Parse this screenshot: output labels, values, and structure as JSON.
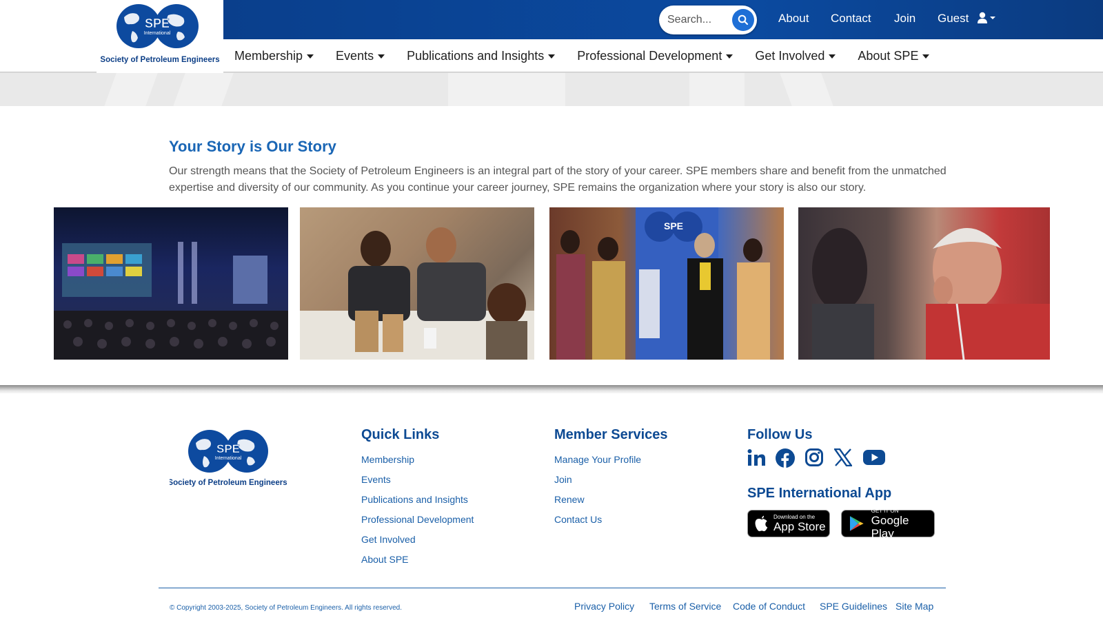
{
  "brand": {
    "logo_text": "SPE",
    "logo_subtext": "International",
    "org_name": "Society of Petroleum Engineers"
  },
  "topbar": {
    "search_placeholder": "Search...",
    "links": [
      "About",
      "Contact",
      "Join"
    ],
    "guest_label": "Guest"
  },
  "nav": {
    "items": [
      "Membership",
      "Events",
      "Publications and Insights",
      "Professional Development",
      "Get Involved",
      "About SPE"
    ]
  },
  "main": {
    "title": "Your Story is Our Story",
    "body": "Our strength means that the Society of Petroleum Engineers is an integral part of the story of your career. SPE members share and benefit from the unmatched expertise and diversity of our community. As you continue your career journey, SPE remains the organization where your story is also our story."
  },
  "footer": {
    "quick_links_title": "Quick Links",
    "quick_links": [
      "Membership",
      "Events",
      "Publications and Insights",
      "Professional Development",
      "Get Involved",
      "About SPE"
    ],
    "member_services_title": "Member Services",
    "member_services": [
      "Manage Your Profile",
      "Join",
      "Renew",
      "Contact Us"
    ],
    "follow_title": "Follow Us",
    "social_icons": [
      "linkedin-icon",
      "facebook-icon",
      "instagram-icon",
      "x-icon",
      "youtube-icon"
    ],
    "app_title": "SPE International App",
    "app_store": {
      "small": "Download on the",
      "big": "App Store"
    },
    "google_play": {
      "small": "GET IT ON",
      "big": "Google Play"
    },
    "copyright": "© Copyright 2003-2025, Society of Petroleum Engineers. All rights reserved.",
    "bottom_links": [
      "Privacy Policy",
      "Terms of Service",
      "Code of Conduct",
      "SPE Guidelines",
      "Site Map"
    ]
  },
  "colors": {
    "brand_blue": "#0b4aa0",
    "title_blue": "#1a66b5",
    "footer_title": "#0d4a93",
    "link_blue": "#1a5fa8"
  }
}
